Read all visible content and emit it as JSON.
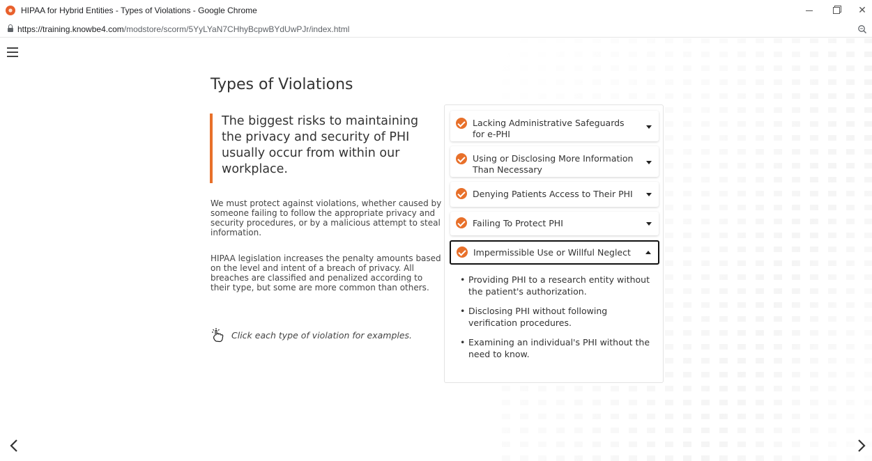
{
  "window": {
    "title": "HIPAA for Hybrid Entities - Types of Violations - Google Chrome",
    "minimize_icon": "minimize-icon",
    "maximize_icon": "restore-icon",
    "close_label": "✕"
  },
  "address": {
    "url_domain": "https://training.knowbe4.com",
    "url_path": "/modstore/scorm/5YyLYaN7CHhyBcpwBYdUwPJr/index.html"
  },
  "page": {
    "title": "Types of Violations",
    "quote": "The biggest risks to maintaining the privacy and security of PHI usually occur from within our workplace.",
    "paragraph1": "We must protect against violations, whether caused by someone failing to follow the appropriate privacy and security procedures, or by a malicious attempt to steal information.",
    "paragraph2": "HIPAA legislation increases the penalty amounts based on the level and intent of a breach of privacy. All breaches are classified and penalized according to their type, but some are more common than others.",
    "hint": "Click each type of violation for examples."
  },
  "accordion": {
    "items": [
      {
        "label_line1": "Lacking Administrative Safeguards",
        "label_line2": "for e-PHI"
      },
      {
        "label_line1": "Using or Disclosing More Information",
        "label_line2": "Than Necessary"
      },
      {
        "label_line1": "Denying Patients Access to Their PHI",
        "label_line2": ""
      },
      {
        "label_line1": "Failing To Protect PHI",
        "label_line2": ""
      },
      {
        "label_line1": "Impermissible Use or Willful Neglect",
        "label_line2": ""
      }
    ],
    "expanded_bullets": [
      "Providing PHI to a research entity without the patient's authorization.",
      "Disclosing PHI without following verification procedures.",
      "Examining an individual's PHI without the need to know."
    ]
  },
  "colors": {
    "accent": "#e8702a",
    "text": "#333333"
  },
  "icons": {
    "menu": "hamburger-menu-icon",
    "check": "check-circle-icon",
    "hand": "tap-hand-icon",
    "prev": "chevron-left-icon",
    "next": "chevron-right-icon",
    "lock": "lock-icon",
    "zoom": "zoom-icon"
  }
}
